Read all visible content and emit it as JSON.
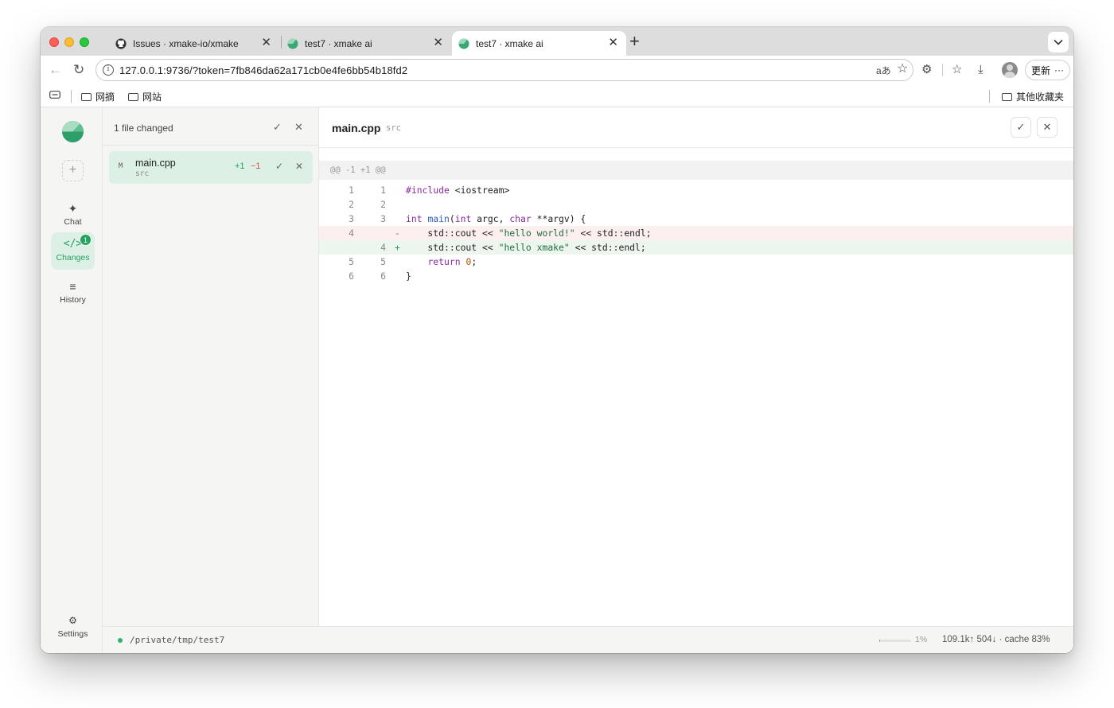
{
  "browser": {
    "tabs": [
      {
        "title": "Issues · xmake-io/xmake",
        "icon": "github-icon"
      },
      {
        "title": "test7 · xmake ai",
        "icon": "xmake-ai-icon"
      },
      {
        "title": "test7 · xmake ai",
        "icon": "xmake-ai-icon",
        "active": true
      }
    ],
    "url": "127.0.0.1:9736/?token=7fb846da62a171cb0e4fe6bb54b18fd2",
    "update_label": "更新",
    "bookmarks": [
      "网摘",
      "网站"
    ],
    "other_bookmarks": "其他收藏夹"
  },
  "rail": {
    "items": [
      {
        "label": "Chat",
        "icon": "sparkle-icon"
      },
      {
        "label": "Changes",
        "icon": "code-icon",
        "badge": "1"
      },
      {
        "label": "History",
        "icon": "list-icon"
      }
    ],
    "settings_label": "Settings"
  },
  "changes_panel": {
    "title": "1 file changed",
    "files": [
      {
        "status": "M",
        "name": "main.cpp",
        "dir": "src",
        "added": "+1",
        "removed": "−1"
      }
    ]
  },
  "diff": {
    "file": "main.cpp",
    "dir": "src",
    "hunk": "@@ -1 +1 @@",
    "lines": [
      {
        "old": "1",
        "new": "1",
        "sign": "",
        "type": "ctx",
        "code": "#include <iostream>"
      },
      {
        "old": "2",
        "new": "2",
        "sign": "",
        "type": "ctx",
        "code": ""
      },
      {
        "old": "3",
        "new": "3",
        "sign": "",
        "type": "ctx",
        "code": "int main(int argc, char **argv) {"
      },
      {
        "old": "4",
        "new": "",
        "sign": "-",
        "type": "del",
        "code": "    std::cout << \"hello world!\" << std::endl;"
      },
      {
        "old": "",
        "new": "4",
        "sign": "+",
        "type": "add",
        "code": "    std::cout << \"hello xmake\" << std::endl;"
      },
      {
        "old": "5",
        "new": "5",
        "sign": "",
        "type": "ctx",
        "code": "    return 0;"
      },
      {
        "old": "6",
        "new": "6",
        "sign": "",
        "type": "ctx",
        "code": "}"
      }
    ]
  },
  "status_bar": {
    "path": "/private/tmp/test7",
    "progress": 0.01,
    "progress_label": "1%",
    "tokens": "109.1k↑ 504↓ · cache 83%"
  },
  "colors": {
    "accent": "#22a35f",
    "added": "#22a35f",
    "removed": "#d54b4b"
  }
}
